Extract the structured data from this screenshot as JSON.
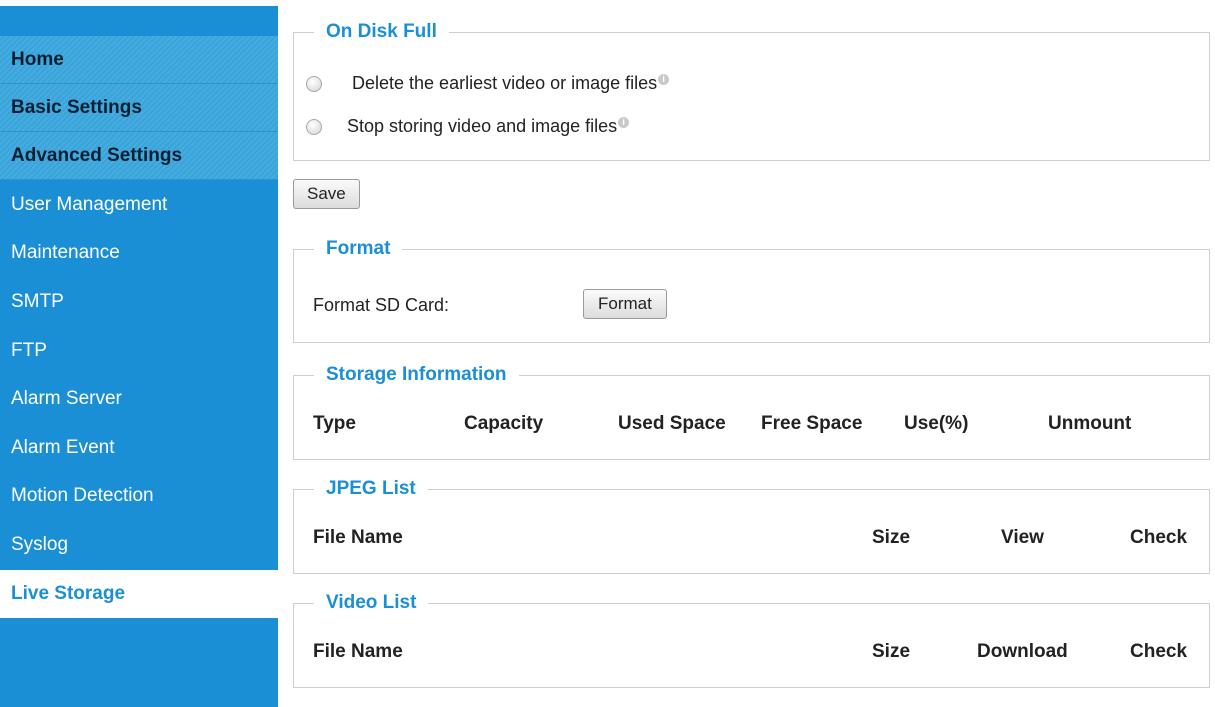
{
  "sidebar": {
    "items": [
      {
        "label": "Home"
      },
      {
        "label": "Basic Settings"
      },
      {
        "label": "Advanced Settings"
      },
      {
        "label": "User Management"
      },
      {
        "label": "Maintenance"
      },
      {
        "label": "SMTP"
      },
      {
        "label": "FTP"
      },
      {
        "label": "Alarm Server"
      },
      {
        "label": "Alarm Event"
      },
      {
        "label": "Motion Detection"
      },
      {
        "label": "Syslog"
      },
      {
        "label": "Live Storage"
      }
    ]
  },
  "disk_full": {
    "title": "On Disk Full",
    "options": [
      {
        "label": "Delete the earliest video or image files",
        "selected": false
      },
      {
        "label": "Stop storing video and image files",
        "selected": false
      }
    ],
    "info_icon": "i"
  },
  "save_label": "Save",
  "format": {
    "title": "Format",
    "label": "Format SD Card:",
    "button": "Format"
  },
  "storage": {
    "title": "Storage Information",
    "columns": [
      "Type",
      "Capacity",
      "Used Space",
      "Free Space",
      "Use(%)",
      "Unmount"
    ]
  },
  "jpeg": {
    "title": "JPEG List",
    "columns": [
      "File Name",
      "Size",
      "View",
      "Check"
    ]
  },
  "video": {
    "title": "Video List",
    "columns": [
      "File Name",
      "Size",
      "Download",
      "Check"
    ]
  },
  "colors": {
    "accent": "#1a8fd6",
    "section_bg": "#3aa4da"
  }
}
